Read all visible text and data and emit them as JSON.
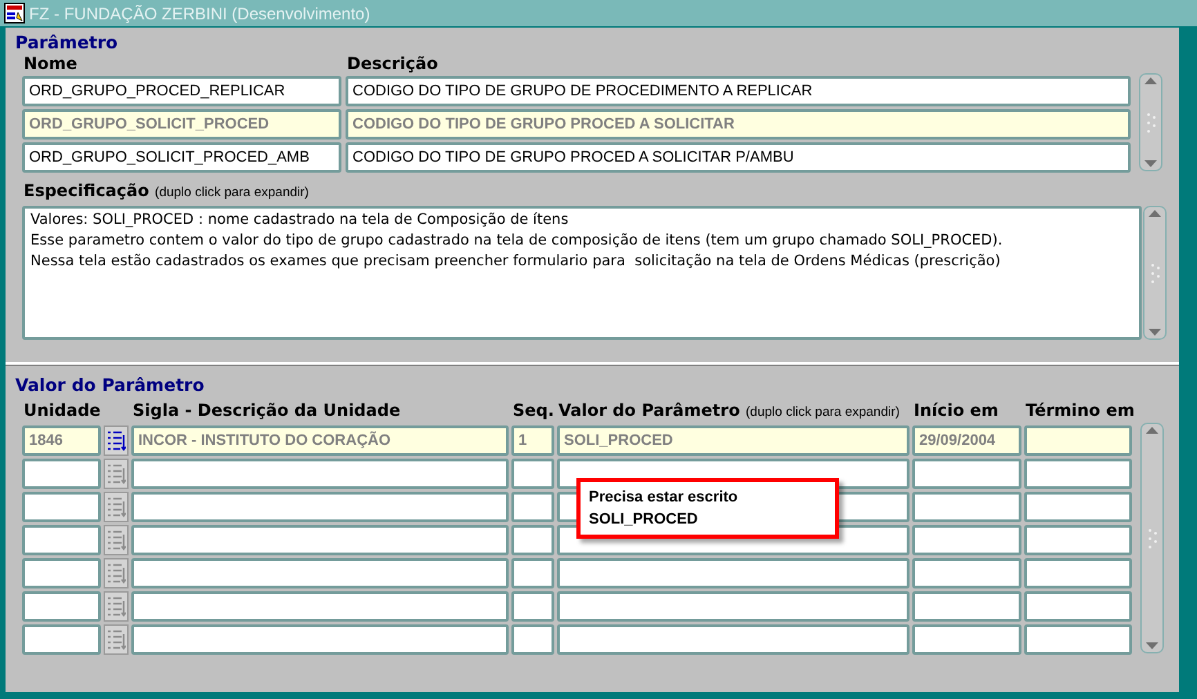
{
  "window": {
    "title": "FZ - FUNDAÇÃO ZERBINI (Desenvolvimento)"
  },
  "parametro": {
    "title": "Parâmetro",
    "columns": [
      "Nome",
      "Descrição"
    ],
    "rows": [
      {
        "nome": "ORD_GRUPO_PROCED_REPLICAR",
        "descricao": "CODIGO DO TIPO DE GRUPO DE PROCEDIMENTO A REPLICAR",
        "selected": false
      },
      {
        "nome": "ORD_GRUPO_SOLICIT_PROCED",
        "descricao": "CODIGO DO TIPO DE GRUPO PROCED A SOLICITAR",
        "selected": true
      },
      {
        "nome": "ORD_GRUPO_SOLICIT_PROCED_AMB",
        "descricao": "CODIGO DO TIPO DE GRUPO PROCED A SOLICITAR P/AMBU",
        "selected": false
      }
    ],
    "especificacao": {
      "label": "Especificação",
      "hint": "(duplo click para expandir)",
      "lines": [
        "Valores: SOLI_PROCED : nome cadastrado na tela de Composição de ítens",
        "Esse parametro contem o valor do tipo de grupo cadastrado na tela de composição de itens (tem um grupo chamado SOLI_PROCED).",
        "Nessa tela estão cadastrados os exames que precisam preencher formulario para  solicitação na tela de Ordens Médicas (prescrição)"
      ]
    }
  },
  "valor_do_parametro": {
    "title": "Valor do Parâmetro",
    "columns": [
      {
        "label": "Unidade"
      },
      {
        "label": "Sigla - Descrição da Unidade"
      },
      {
        "label": "Seq."
      },
      {
        "label": "Valor do Parâmetro",
        "hint": "(duplo click para expandir)"
      },
      {
        "label": "Início em"
      },
      {
        "label": "Término em"
      }
    ],
    "rows": [
      {
        "unidade": "1846",
        "sigla_descricao": "INCOR - INSTITUTO DO CORAÇÃO",
        "seq": "1",
        "valor": "SOLI_PROCED",
        "inicio_em": "29/09/2004",
        "selected": true
      },
      {
        "selected": false
      },
      {
        "selected": false
      },
      {
        "selected": false
      },
      {
        "selected": false
      },
      {
        "selected": false
      },
      {
        "selected": false
      }
    ]
  },
  "callout": {
    "lines": [
      "Precisa estar escrito",
      "SOLI_PROCED"
    ]
  }
}
